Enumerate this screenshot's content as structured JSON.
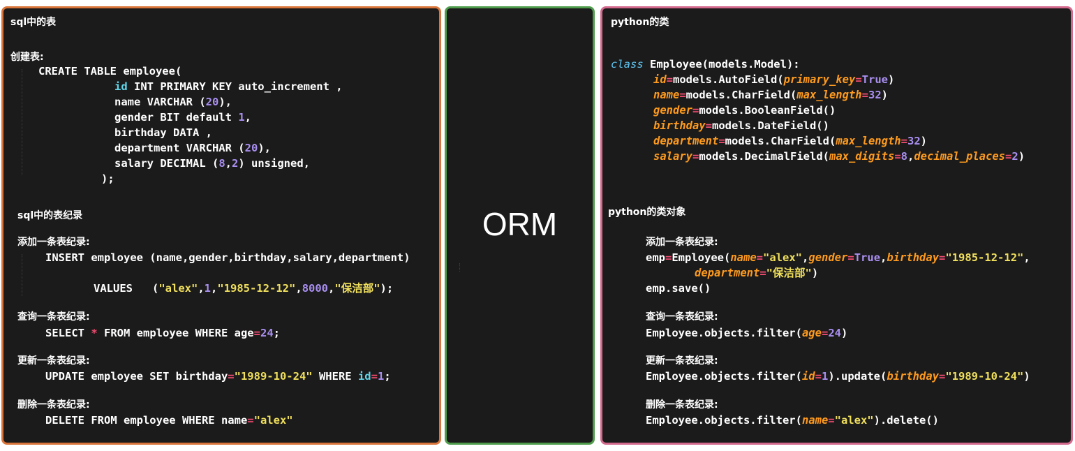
{
  "left_panel": {
    "title": "sql中的表",
    "create_label": "创建表:",
    "create_table": "CREATE TABLE employee(",
    "col_id_a": "id",
    "col_id_b": " INT PRIMARY KEY auto_increment ,",
    "col_name_a": "name VARCHAR (",
    "col_name_num": "20",
    "col_name_b": "),",
    "col_gender_a": "gender BIT default ",
    "col_gender_num": "1",
    "col_gender_b": ",",
    "col_birthday": "birthday DATA ,",
    "col_dept_a": "department VARCHAR (",
    "col_dept_num": "20",
    "col_dept_b": "),",
    "col_salary_a": "salary DECIMAL (",
    "col_salary_n1": "8",
    "col_salary_comma": ",",
    "col_salary_n2": "2",
    "col_salary_b": ") unsigned,",
    "close": ");",
    "records_title": "sql中的表纪录",
    "insert_label": "添加一条表纪录:",
    "insert_line": "INSERT employee (name,gender,birthday,salary,department)",
    "values_kw": "VALUES   (",
    "values_s1": "\"alex\"",
    "values_c1": ",",
    "values_n1": "1",
    "values_c2": ",",
    "values_s2": "\"1985-12-12\"",
    "values_c3": ",",
    "values_n2": "8000",
    "values_c4": ",",
    "values_s3": "\"保洁部\"",
    "values_end": ");",
    "select_label": "查询一条表纪录:",
    "select_a": "SELECT ",
    "select_star": "*",
    "select_b": " FROM employee WHERE age",
    "select_eq": "=",
    "select_num": "24",
    "select_end": ";",
    "update_label": "更新一条表纪录:",
    "update_a": "UPDATE employee SET birthday",
    "update_eq": "=",
    "update_str": "\"1989-10-24\"",
    "update_b": " WHERE ",
    "update_id": "id",
    "update_eq2": "=",
    "update_num": "1",
    "update_end": ";",
    "delete_label": "删除一条表纪录:",
    "delete_a": "DELETE FROM employee WHERE name",
    "delete_eq": "=",
    "delete_str": "\"alex\""
  },
  "middle_panel": {
    "label": "ORM"
  },
  "right_panel": {
    "title": "python的类",
    "class_kw": "class",
    "class_rest": " Employee(models.Model):",
    "f_id": "id",
    "f_id_eq": "=",
    "f_id_a": "models.AutoField(",
    "f_id_p": "primary_key",
    "f_id_eq2": "=",
    "f_id_v": "True",
    "f_id_b": ")",
    "f_name": "name",
    "f_name_eq": "=",
    "f_name_a": "models.CharField(",
    "f_name_p": "max_length",
    "f_name_eq2": "=",
    "f_name_v": "32",
    "f_name_b": ")",
    "f_gender": "gender",
    "f_gender_eq": "=",
    "f_gender_a": "models.BooleanField()",
    "f_birthday": "birthday",
    "f_birthday_eq": "=",
    "f_birthday_a": "models.DateField()",
    "f_dept": "department",
    "f_dept_eq": "=",
    "f_dept_a": "models.CharField(",
    "f_dept_p": "max_length",
    "f_dept_eq2": "=",
    "f_dept_v": "32",
    "f_dept_b": ")",
    "f_salary": "salary",
    "f_salary_eq": "=",
    "f_salary_a": "models.DecimalField(",
    "f_salary_p1": "max_digits",
    "f_salary_eq2": "=",
    "f_salary_v1": "8",
    "f_salary_c": ",",
    "f_salary_p2": "decimal_places",
    "f_salary_eq3": "=",
    "f_salary_v2": "2",
    "f_salary_b": ")",
    "objects_title": "python的类对象",
    "add_label": "添加一条表纪录:",
    "emp_a": "emp",
    "emp_eq": "=",
    "emp_b": "Employee(",
    "emp_p1": "name",
    "emp_eq1": "=",
    "emp_s1": "\"alex\"",
    "emp_c1": ",",
    "emp_p2": "gender",
    "emp_eq2": "=",
    "emp_v2": "True",
    "emp_c2": ",",
    "emp_p3": "birthday",
    "emp_eq3": "=",
    "emp_s3": "\"1985-12-12\"",
    "emp_c3": ",",
    "emp_p4": "department",
    "emp_eq4": "=",
    "emp_s4": "\"保洁部\"",
    "emp_end": ")",
    "save": "emp.save()",
    "query_label": "查询一条表纪录:",
    "query_a": "Employee.objects.filter(",
    "query_p": "age",
    "query_eq": "=",
    "query_v": "24",
    "query_b": ")",
    "upd_label": "更新一条表纪录:",
    "upd_a": "Employee.objects.filter(",
    "upd_p": "id",
    "upd_eq": "=",
    "upd_v": "1",
    "upd_b": ").update(",
    "upd_p2": "birthday",
    "upd_eq2": "=",
    "upd_s": "\"1989-10-24\"",
    "upd_c": ")",
    "del_label": "删除一条表纪录:",
    "del_a": "Employee.objects.filter(",
    "del_p": "name",
    "del_eq": "=",
    "del_s": "\"alex\"",
    "del_b": ").delete()"
  },
  "colors": {
    "left_border": "#d9753a",
    "middle_border": "#4f9d4c",
    "right_border": "#d4698e",
    "background": "#1b1b1b",
    "keyword": "#5fc6f2",
    "number": "#a98ff0",
    "string": "#f0df5c",
    "operator": "#f24d72",
    "param": "#fd9a1f"
  }
}
